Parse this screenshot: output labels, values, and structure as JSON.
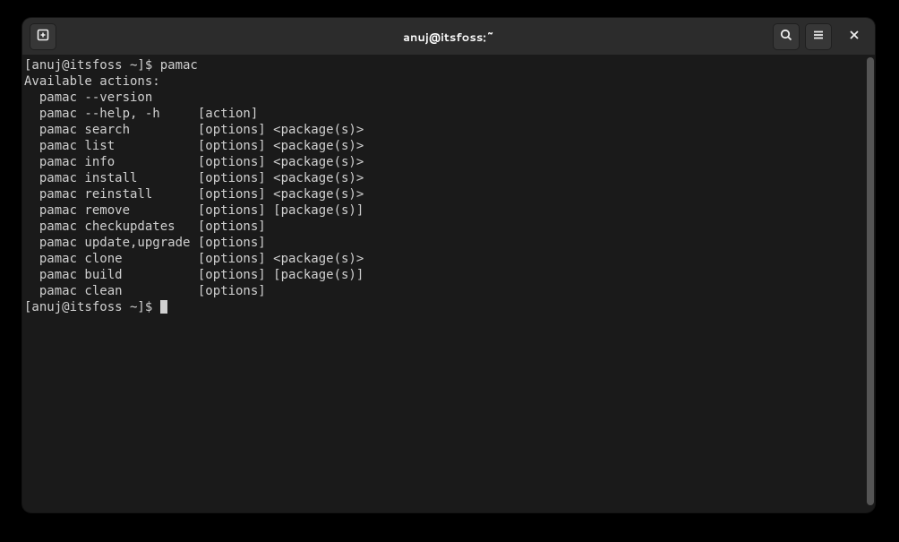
{
  "titlebar": {
    "title": "anuj@itsfoss:~"
  },
  "terminal": {
    "prompt1": "[anuj@itsfoss ~]$ ",
    "command1": "pamac",
    "lines": [
      "Available actions:",
      "  pamac --version",
      "  pamac --help, -h     [action]",
      "  pamac search         [options] <package(s)>",
      "  pamac list           [options] <package(s)>",
      "  pamac info           [options] <package(s)>",
      "  pamac install        [options] <package(s)>",
      "  pamac reinstall      [options] <package(s)>",
      "  pamac remove         [options] [package(s)]",
      "  pamac checkupdates   [options]",
      "  pamac update,upgrade [options]",
      "  pamac clone          [options] <package(s)>",
      "  pamac build          [options] [package(s)]",
      "  pamac clean          [options]"
    ],
    "prompt2": "[anuj@itsfoss ~]$ "
  }
}
